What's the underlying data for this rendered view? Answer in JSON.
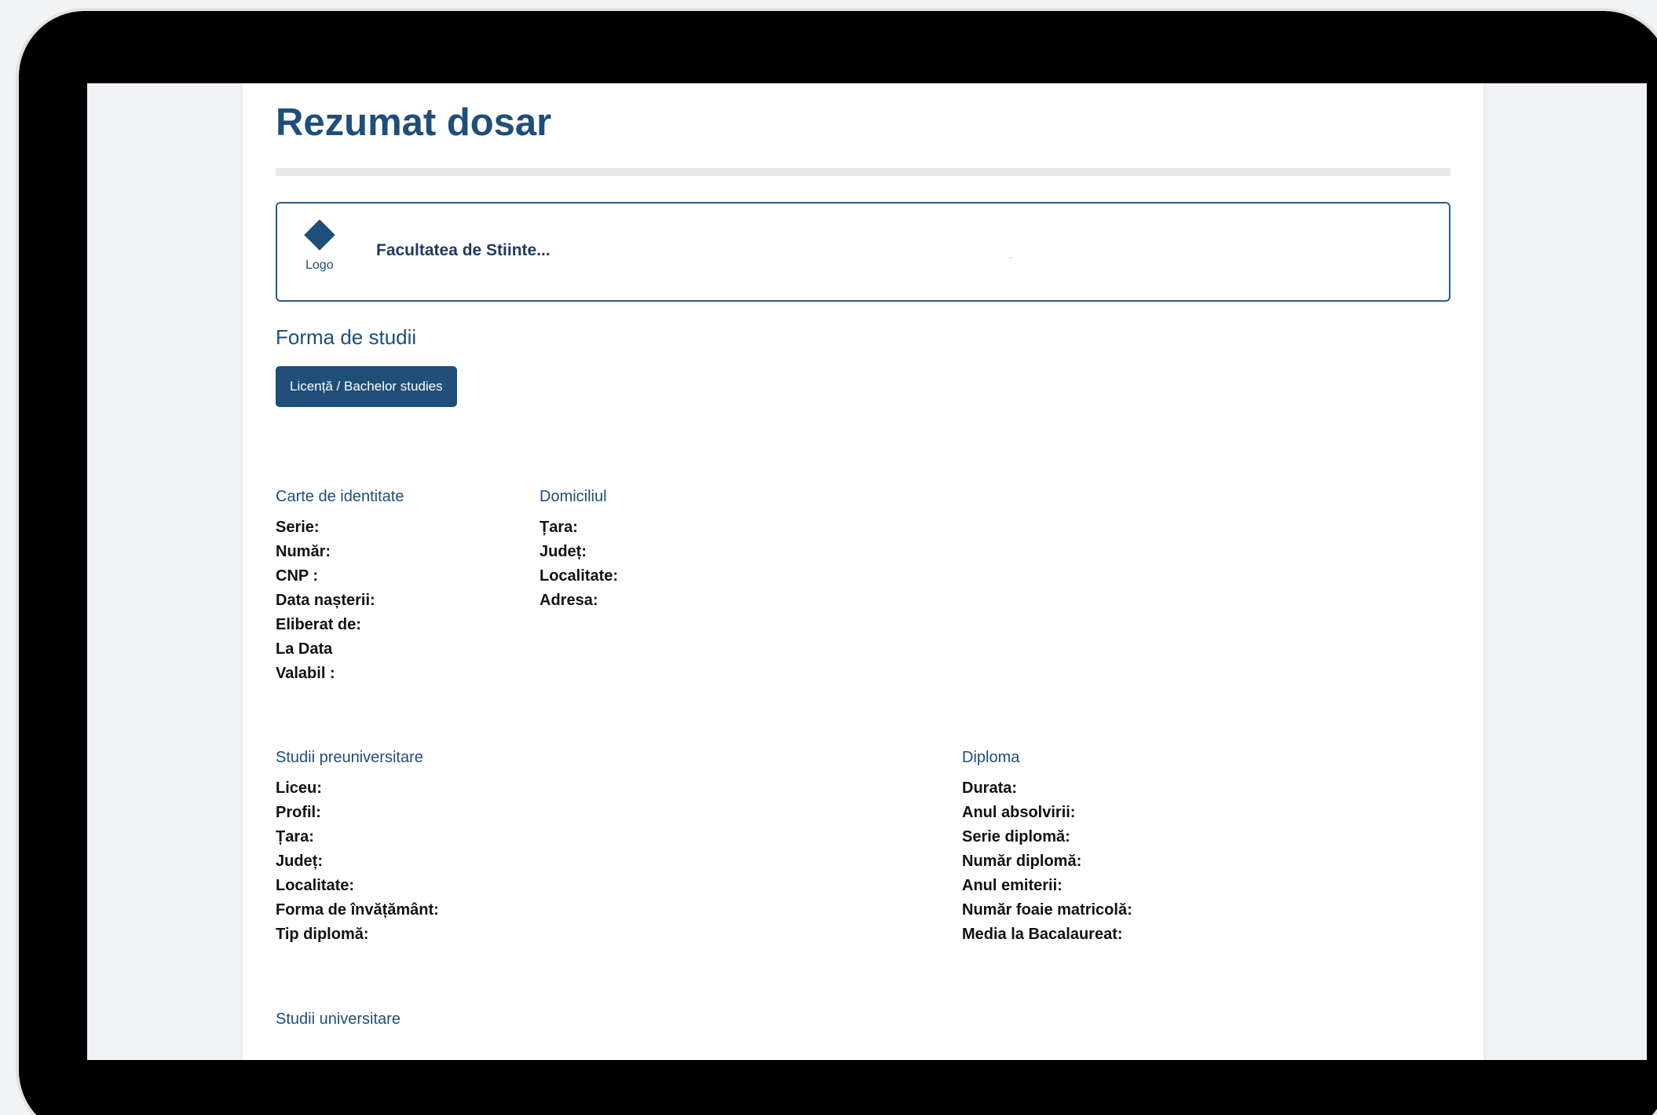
{
  "page": {
    "title": "Rezumat dosar"
  },
  "faculty": {
    "logo_label": "Logo",
    "name": "Facultatea de Stiinte..."
  },
  "study_form": {
    "label": "Forma de studii",
    "button_label": "Licență / Bachelor studies"
  },
  "identity_card": {
    "label": "Carte de identitate",
    "fields": [
      "Serie:",
      "Număr:",
      "CNP :",
      "Data nașterii:",
      "Eliberat de:",
      "La Data",
      "Valabil :"
    ]
  },
  "domicile": {
    "label": "Domiciliul",
    "fields": [
      "Țara:",
      "Județ:",
      "Localitate:",
      "Adresa:"
    ]
  },
  "pre_university": {
    "label": "Studii preuniversitare",
    "fields": [
      "Liceu:",
      "Profil:",
      "Țara:",
      "Județ:",
      "Localitate:",
      "Forma de învățământ:",
      "Tip diplomă:"
    ]
  },
  "diploma": {
    "label": "Diploma",
    "fields": [
      "Durata:",
      "Anul absolvirii:",
      "Serie diplomă:",
      "Număr diplomă:",
      "Anul emiterii:",
      "Număr foaie matricolă:",
      "Media la Bacalaureat:"
    ]
  },
  "university": {
    "label": "Studii universitare"
  },
  "colors": {
    "primary": "#1f4e79",
    "text": "#111111",
    "divider": "#e6e8eb",
    "bezel": "#000000"
  },
  "icons": {
    "logo": "diamond-logo-icon"
  }
}
